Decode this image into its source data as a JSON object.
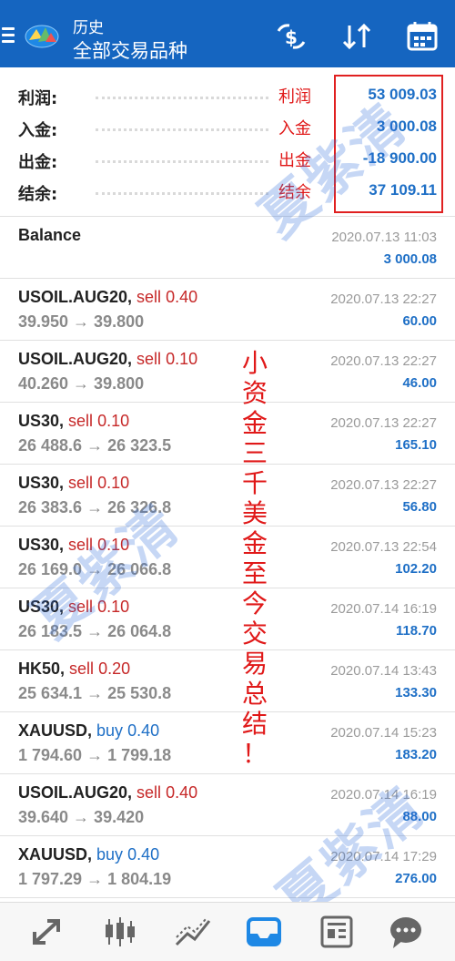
{
  "header": {
    "subtitle": "历史",
    "title": "全部交易品种"
  },
  "summary": {
    "rows": [
      {
        "label": "利润:",
        "annotation": "利润",
        "value": "53 009.03"
      },
      {
        "label": "入金:",
        "annotation": "入金",
        "value": "3 000.08"
      },
      {
        "label": "出金:",
        "annotation": "出金",
        "value": "-18 900.00"
      },
      {
        "label": "结余:",
        "annotation": "结余",
        "value": "37 109.11"
      }
    ]
  },
  "items": [
    {
      "symbol": "Balance",
      "side": "",
      "vol": "",
      "prices": "",
      "date": "2020.07.13 11:03",
      "profit": "3 000.08"
    },
    {
      "symbol": "USOIL.AUG20,",
      "side": "sell",
      "vol": "0.40",
      "prices": "39.950 → 39.800",
      "date": "2020.07.13 22:27",
      "profit": "60.00"
    },
    {
      "symbol": "USOIL.AUG20,",
      "side": "sell",
      "vol": "0.10",
      "prices": "40.260 → 39.800",
      "date": "2020.07.13 22:27",
      "profit": "46.00"
    },
    {
      "symbol": "US30,",
      "side": "sell",
      "vol": "0.10",
      "prices": "26 488.6 → 26 323.5",
      "date": "2020.07.13 22:27",
      "profit": "165.10"
    },
    {
      "symbol": "US30,",
      "side": "sell",
      "vol": "0.10",
      "prices": "26 383.6 → 26 326.8",
      "date": "2020.07.13 22:27",
      "profit": "56.80"
    },
    {
      "symbol": "US30,",
      "side": "sell",
      "vol": "0.10",
      "prices": "26 169.0 → 26 066.8",
      "date": "2020.07.13 22:54",
      "profit": "102.20"
    },
    {
      "symbol": "US30,",
      "side": "sell",
      "vol": "0.10",
      "prices": "26 183.5 → 26 064.8",
      "date": "2020.07.14 16:19",
      "profit": "118.70"
    },
    {
      "symbol": "HK50,",
      "side": "sell",
      "vol": "0.20",
      "prices": "25 634.1 → 25 530.8",
      "date": "2020.07.14 13:43",
      "profit": "133.30"
    },
    {
      "symbol": "XAUUSD,",
      "side": "buy",
      "vol": "0.40",
      "prices": "1 794.60 → 1 799.18",
      "date": "2020.07.14 15:23",
      "profit": "183.20"
    },
    {
      "symbol": "USOIL.AUG20,",
      "side": "sell",
      "vol": "0.40",
      "prices": "39.640 → 39.420",
      "date": "2020.07.14 16:19",
      "profit": "88.00"
    },
    {
      "symbol": "XAUUSD,",
      "side": "buy",
      "vol": "0.40",
      "prices": "1 797.29 → 1 804.19",
      "date": "2020.07.14 17:29",
      "profit": "276.00"
    }
  ],
  "annotation_vertical": [
    "小",
    "资",
    "金",
    "三",
    "千",
    "美",
    "金",
    "至",
    "今",
    "交",
    "易",
    "总",
    "结",
    "！"
  ],
  "watermark": "夏紫清",
  "icons": {
    "menu": "menu-icon",
    "logo": "app-logo-icon",
    "currency": "currency-exchange-icon",
    "sort": "sort-icon",
    "calendar": "calendar-icon",
    "nav": [
      "quotes-icon",
      "chart-icon",
      "trade-icon",
      "history-icon",
      "news-icon",
      "chat-icon"
    ]
  },
  "colors": {
    "appbar": "#1565c0",
    "value_blue": "#1e6fc6",
    "sell_red": "#c62828",
    "annotation_red": "#e01818",
    "active_nav": "#1e88e5"
  }
}
